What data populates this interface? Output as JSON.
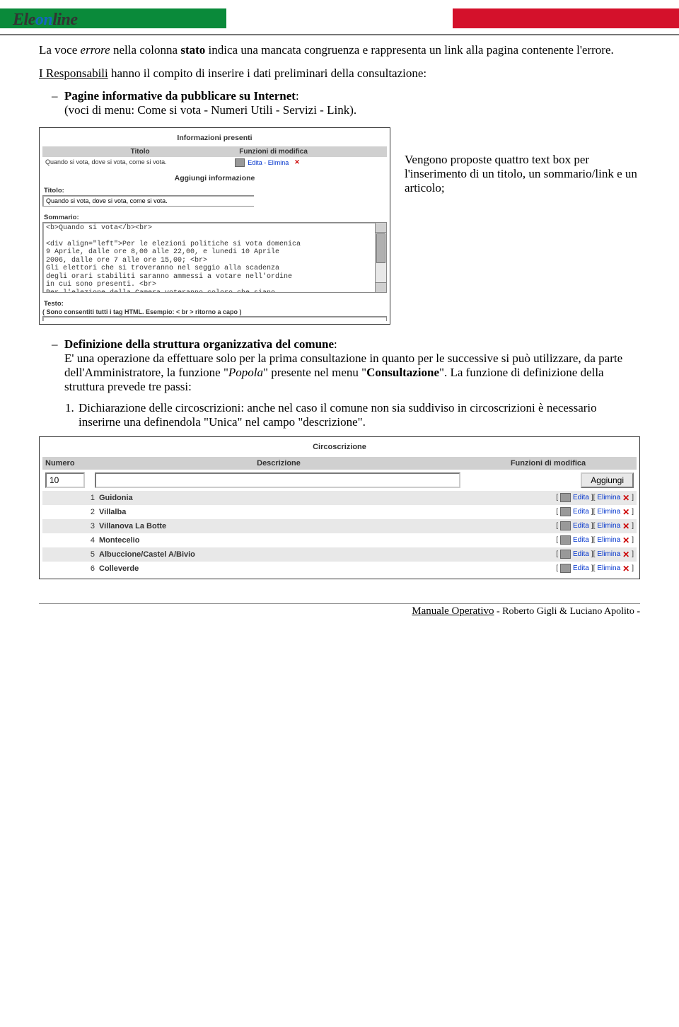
{
  "logo": {
    "ele": "Ele",
    "on": "on",
    "line": "line"
  },
  "p1": {
    "t1": "La voce ",
    "em": "errore",
    "t2": " nella colonna ",
    "b": "stato",
    "t3": " indica una mancata congruenza e rappresenta un link alla pagina contenente l'errore."
  },
  "p2": {
    "u": "I Responsabili",
    "rest": " hanno il compito di inserire i dati preliminari della consultazione:"
  },
  "bullet1": {
    "b": "Pagine informative da pubblicare su Internet",
    "after": ":"
  },
  "bullet1_line2": "(voci di menu: Come si vota - Numeri Utili - Servizi - Link).",
  "side_text": " Vengono proposte quattro text box per l'inserimento di un titolo, un sommario/link e un articolo;",
  "fig1": {
    "title": "Informazioni presenti",
    "col_l": "Titolo",
    "col_r": "Funzioni di modifica",
    "row_l": "Quando si vota, dove si vota, come si vota.",
    "row_r": "Edita - Elimina",
    "add_title": "Aggiungi informazione",
    "lbl_titolo": "Titolo:",
    "val_titolo": "Quando si vota, dove si vota, come si vota.",
    "lbl_somm": "Sommario:",
    "ta_text": "<b>Quando si vota</b><br>\n\n<div align=\"left\">Per le elezioni politiche si vota domenica\n9 Aprile, dalle ore 8,00 alle 22,00, e lunedi 10 Aprile\n2006, dalle ore 7 alle ore 15,00; <br>\nGli elettori che si troveranno nel seggio alla scadenza\ndegli orari stabiliti saranno ammessi a votare nell'ordine\nin cui sono presenti. <br>\nPer l'elezione della Camera voteranno coloro che siano",
    "lbl_testo": "Testo:",
    "hint": "( Sono consentiti tutti i tag HTML. Esempio: < br > ritorno a capo )"
  },
  "bullet2": {
    "b": "Definizione della struttura organizzativa del comune",
    "after": ":"
  },
  "bullet2_p": {
    "t1": "E' una operazione da effettuare solo per la prima consultazione in quanto per le successive si può utilizzare, da parte dell'Amministratore, la funzione \"",
    "em": "Popola",
    "t2": "\" presente nel menu \"",
    "b": "Consultazione",
    "t3": "\". La funzione di definizione della struttura prevede tre passi:"
  },
  "num1": "Dichiarazione delle circoscrizioni: anche nel caso il comune non sia suddiviso in circoscrizioni è necessario inserirne una definendola \"Unica\" nel campo \"descrizione\".",
  "fig2": {
    "title": "Circoscrizione",
    "hdr_n": "Numero",
    "hdr_d": "Descrizione",
    "hdr_f": "Funzioni di modifica",
    "new_n": "10",
    "btn_add": "Aggiungi",
    "rows": [
      {
        "n": "1",
        "d": "Guidonia"
      },
      {
        "n": "2",
        "d": "Villalba"
      },
      {
        "n": "3",
        "d": "Villanova La Botte"
      },
      {
        "n": "4",
        "d": "Montecelio"
      },
      {
        "n": "5",
        "d": "Albuccione/Castel A/Bivio"
      },
      {
        "n": "6",
        "d": "Colleverde"
      }
    ],
    "act_edit": "Edita",
    "act_del": "Elimina"
  },
  "footer": {
    "u": "Manuale Operativo",
    "rest": " - Roberto Gigli & Luciano Apolito -"
  }
}
